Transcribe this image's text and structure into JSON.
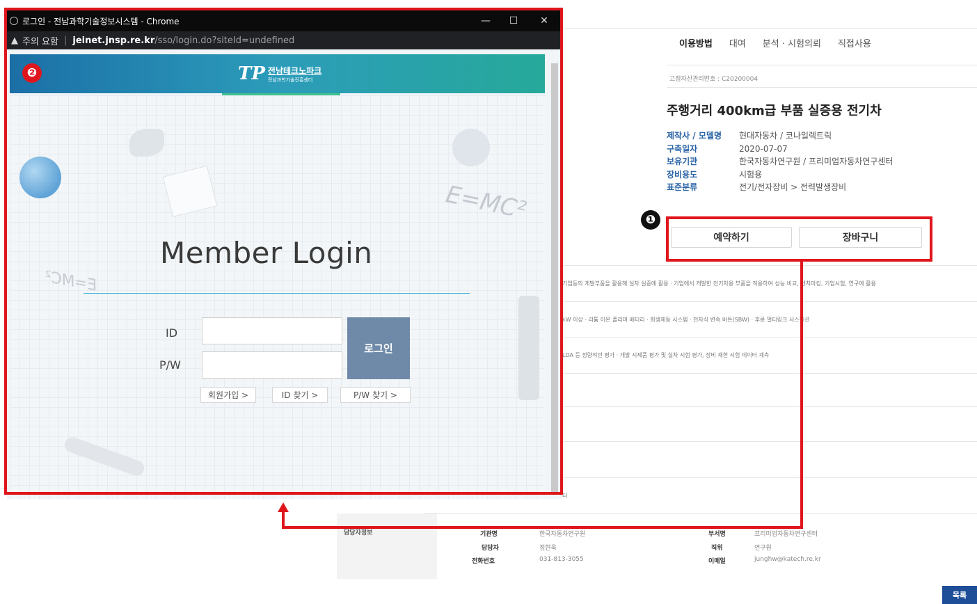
{
  "page": {
    "tabs": [
      "이용방법",
      "대여",
      "분석 · 시험의뢰",
      "직접사용"
    ],
    "mgmt_number": "고정자산관리번호 : C20200004",
    "title": "주행거리 400km급 부품 실증용 전기차",
    "specs": [
      {
        "key": "제작사 / 모델명",
        "value": "현대자동차 / 코나일렉트릭"
      },
      {
        "key": "구축일자",
        "value": "2020-07-07"
      },
      {
        "key": "보유기관",
        "value": "한국자동차연구원 / 프리미엄자동차연구센터"
      },
      {
        "key": "장비용도",
        "value": "시험용"
      },
      {
        "key": "표준분류",
        "value": "전기/전자장비 > 전력발생장비"
      }
    ],
    "reserve_button": "예약하기",
    "cart_button": "장바구니",
    "descriptions": [
      "기업등의 개발부품을 활용해 실차 실증에 활용 · 기업에서 개발한 전기차용 부품을 적용하여 성능 비교, 벤치마킹, 기업시험, 연구에 활용",
      "kW 이상 · 리튬 이온 폴리머 배터리 · 회생제동 시스템 · 전자식 변속 버튼(SBW) · 후륜 멀티링크 서스펜션",
      "LDA 등 정량적인 평가 · 개발 시제품 평가 및 실차 시험 평가, 장비 재현 시험 데이터 계측",
      "터"
    ],
    "contact": {
      "section_label": "담당자정보",
      "org_label": "기관명",
      "org_value": "한국자동차연구원",
      "manager_label": "담당자",
      "manager_value": "정현욱",
      "phone_label": "전화번호",
      "phone_value": "031-813-3055",
      "dept_label": "부서명",
      "dept_value": "프리미엄자동차연구센터",
      "position_label": "직위",
      "position_value": "연구원",
      "email_label": "이메일",
      "email_value": "junghw@katech.re.kr"
    },
    "list_button": "목록"
  },
  "annotations": {
    "marker_1": "❶",
    "marker_2": "❷",
    "color": "#e0161d"
  },
  "popup": {
    "window_title": "로그인 - 전남과학기술정보시스템 - Chrome",
    "controls": {
      "minimize": "—",
      "maximize": "☐",
      "close": "✕"
    },
    "warning_text": "주의 요함",
    "url_host": "jeinet.jnsp.re.kr",
    "url_path": "/sso/login.do?siteId=undefined",
    "logo_mark": "TP",
    "logo_name": "전남테크노파크",
    "logo_sub": "전남과학기술진흥센터",
    "heading": "Member Login",
    "id_label": "ID",
    "pw_label": "P/W",
    "id_value": "",
    "pw_value": "",
    "login_button": "로그인",
    "join_link": "회원가입  >",
    "find_id_link": "ID 찾기  >",
    "find_pw_link": "P/W 찾기  >",
    "deco_formula": "E=MC²",
    "deco_formula_mirror": "E=MC²",
    "header_gradient": [
      "#1b6fa6",
      "#2c9cba",
      "#26a99a"
    ]
  }
}
